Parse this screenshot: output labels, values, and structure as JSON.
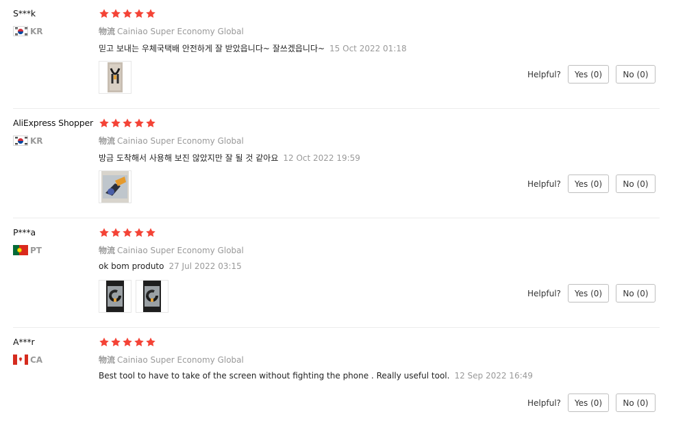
{
  "colors": {
    "star": "#f44336",
    "muted_text": "#999999",
    "divider": "#ececec",
    "button_border": "#bdbdbd"
  },
  "helpful_label": "Helpful?",
  "shipping_label": "物流",
  "reviews": [
    {
      "user": "S***k",
      "country_code": "KR",
      "flag_icon": "south-korea-flag-icon",
      "rating": 5,
      "shipping_method": "Cainiao Super Economy Global",
      "text": "믿고 보내는 우체국택배 안전하게 잘 받았읍니다~ 잘쓰겠읍니다~",
      "date": "15 Oct 2022 01:18",
      "photos": [
        "product-photo-phone-holder"
      ],
      "yes_label": "Yes (0)",
      "no_label": "No (0)"
    },
    {
      "user": "AliExpress Shopper",
      "country_code": "KR",
      "flag_icon": "south-korea-flag-icon",
      "rating": 5,
      "shipping_method": "Cainiao Super Economy Global",
      "text": "방금 도착해서 사용해 보진 않았지만 잘 될 것 같아요",
      "date": "12 Oct 2022 19:59",
      "photos": [
        "product-photo-clamp-in-package"
      ],
      "yes_label": "Yes (0)",
      "no_label": "No (0)"
    },
    {
      "user": "P***a",
      "country_code": "PT",
      "flag_icon": "portugal-flag-icon",
      "rating": 5,
      "shipping_method": "Cainiao Super Economy Global",
      "text": "ok bom produto",
      "date": "27 Jul 2022 03:15",
      "photos": [
        "product-photo-clamp-1",
        "product-photo-clamp-2"
      ],
      "yes_label": "Yes (0)",
      "no_label": "No (0)"
    },
    {
      "user": "A***r",
      "country_code": "CA",
      "flag_icon": "canada-flag-icon",
      "rating": 5,
      "shipping_method": "Cainiao Super Economy Global",
      "text": "Best tool to have to take of the screen without fighting the phone . Really useful tool.",
      "date": "12 Sep 2022 16:49",
      "photos": [],
      "yes_label": "Yes (0)",
      "no_label": "No (0)"
    }
  ]
}
